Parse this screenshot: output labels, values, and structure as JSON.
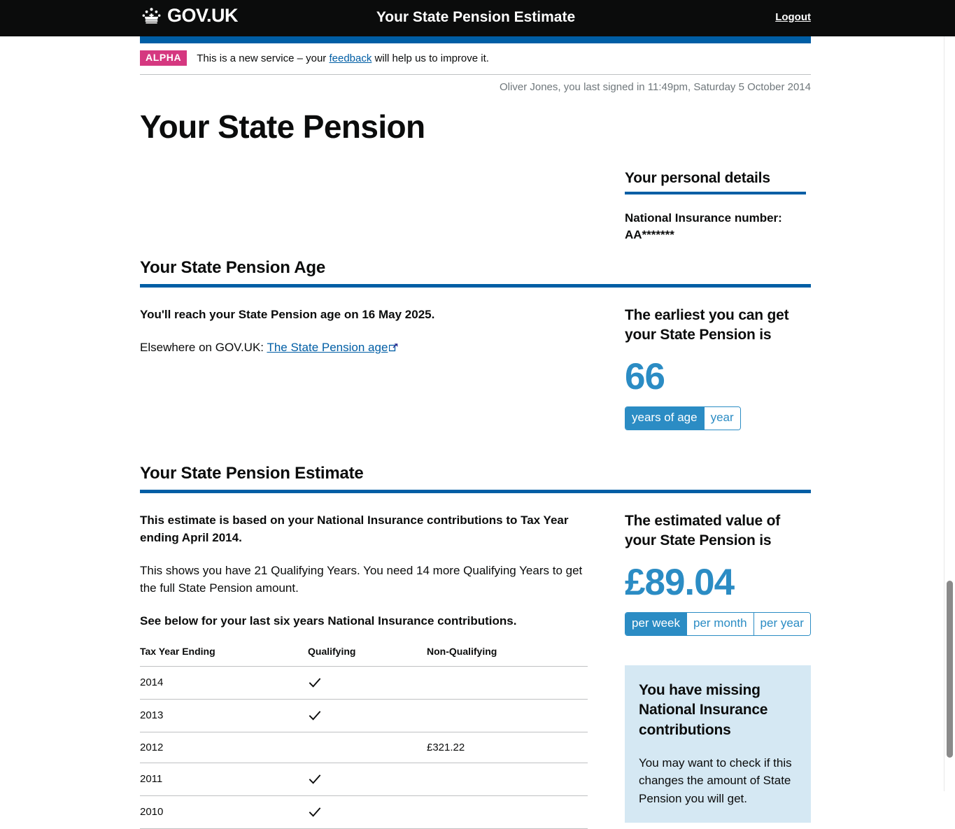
{
  "header": {
    "brand": "GOV.UK",
    "crown_icon": "crown-icon",
    "title": "Your State Pension Estimate",
    "logout_label": "Logout"
  },
  "phase_banner": {
    "tag": "ALPHA",
    "text_before": "This is a new service – your ",
    "link_label": "feedback",
    "text_after": " will help us to improve it."
  },
  "session": {
    "last_signed_in": "Oliver Jones, you last signed in 11:49pm, Saturday 5 October 2014"
  },
  "page": {
    "title": "Your State Pension"
  },
  "personal_details": {
    "heading": "Your personal details",
    "ni_label": "National Insurance number:",
    "ni_value": "AA*******"
  },
  "pension_age": {
    "heading": "Your State Pension Age",
    "statement": "You'll reach your State Pension age on 16 May 2025.",
    "elsewhere_prefix": "Elsewhere on GOV.UK: ",
    "elsewhere_link": "The State Pension age",
    "external_link_icon": "external-link-icon",
    "panel": {
      "title": "The earliest you can get your State Pension is",
      "value": "66",
      "toggles": [
        {
          "label": "years of age",
          "selected": true
        },
        {
          "label": "year",
          "selected": false
        }
      ]
    }
  },
  "pension_estimate": {
    "heading": "Your State Pension Estimate",
    "basis_text": "This estimate is based on your National Insurance contributions to Tax Year ending April 2014.",
    "qualifying_text": "This shows you have 21 Qualifying Years. You need 14 more Qualifying Years to get the full State Pension amount.",
    "see_below_text": "See below for your last six years National Insurance contributions.",
    "panel": {
      "title": "The estimated value of your State Pension is",
      "value": "£89.04",
      "toggles": [
        {
          "label": "per week",
          "selected": true
        },
        {
          "label": "per month",
          "selected": false
        },
        {
          "label": "per year",
          "selected": false
        }
      ]
    },
    "info_box": {
      "title": "You have missing National Insurance contributions",
      "text": "You may want to check if this changes the amount of State Pension you will get."
    },
    "table": {
      "columns": [
        "Tax Year Ending",
        "Qualifying",
        "Non-Qualifying"
      ],
      "rows": [
        {
          "year": "2014",
          "qualifying": true,
          "non_qualifying": ""
        },
        {
          "year": "2013",
          "qualifying": true,
          "non_qualifying": ""
        },
        {
          "year": "2012",
          "qualifying": false,
          "non_qualifying": "£321.22"
        },
        {
          "year": "2011",
          "qualifying": true,
          "non_qualifying": ""
        },
        {
          "year": "2010",
          "qualifying": true,
          "non_qualifying": ""
        }
      ]
    }
  },
  "colors": {
    "govuk_blue": "#005ea5",
    "link_blue": "#005ea5",
    "figure_blue": "#2b8cc4",
    "alpha_pink": "#d53880",
    "info_box_bg": "#d5e8f3",
    "header_black": "#0b0c0c"
  }
}
